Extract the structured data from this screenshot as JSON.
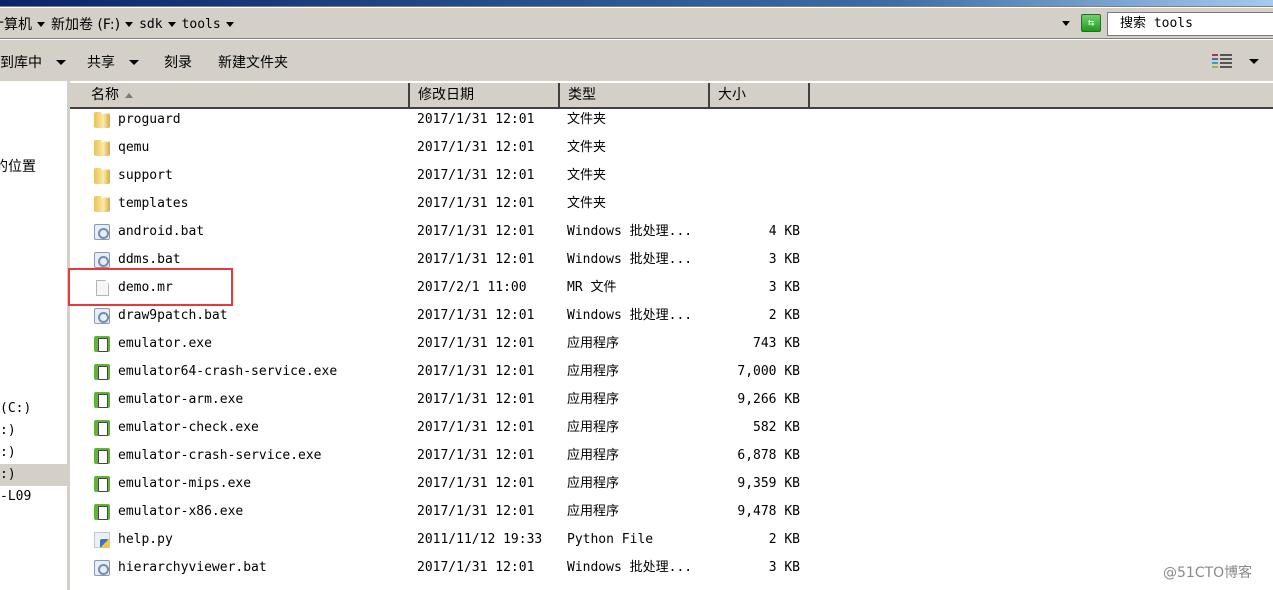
{
  "address_bar": {
    "breadcrumbs": [
      "计算机",
      "新加卷 (F:)",
      "sdk",
      "tools"
    ],
    "search_placeholder": "搜索 tools"
  },
  "toolbar": {
    "include_in_library": "包含到库中",
    "share": "共享",
    "burn": "刻录",
    "new_folder": "新建文件夹"
  },
  "sidebar": {
    "items": [
      {
        "label": "最近访问的位置",
        "visible": "的位置"
      },
      {
        "label": "本地磁盘 (C:)",
        "visible": "(C:)"
      },
      {
        "label": "(D:)",
        "visible": ":)"
      },
      {
        "label": "(E:)",
        "visible": ":)"
      },
      {
        "label": "新加卷 (F:)",
        "visible": ":)",
        "selected": true
      },
      {
        "label": "-L09",
        "visible": "-L09"
      }
    ]
  },
  "columns": {
    "name": "名称",
    "date": "修改日期",
    "type": "类型",
    "size": "大小"
  },
  "files": [
    {
      "name": "proguard",
      "date": "2017/1/31 12:01",
      "type": "文件夹",
      "size": "",
      "icon": "folder-icon"
    },
    {
      "name": "qemu",
      "date": "2017/1/31 12:01",
      "type": "文件夹",
      "size": "",
      "icon": "folder-icon"
    },
    {
      "name": "support",
      "date": "2017/1/31 12:01",
      "type": "文件夹",
      "size": "",
      "icon": "folder-icon"
    },
    {
      "name": "templates",
      "date": "2017/1/31 12:01",
      "type": "文件夹",
      "size": "",
      "icon": "folder-icon"
    },
    {
      "name": "android.bat",
      "date": "2017/1/31 12:01",
      "type": "Windows 批处理...",
      "size": "4 KB",
      "icon": "batch-file-icon"
    },
    {
      "name": "ddms.bat",
      "date": "2017/1/31 12:01",
      "type": "Windows 批处理...",
      "size": "3 KB",
      "icon": "batch-file-icon"
    },
    {
      "name": "demo.mr",
      "date": "2017/2/1 11:00",
      "type": "MR 文件",
      "size": "3 KB",
      "icon": "file-icon",
      "highlighted": true
    },
    {
      "name": "draw9patch.bat",
      "date": "2017/1/31 12:01",
      "type": "Windows 批处理...",
      "size": "2 KB",
      "icon": "batch-file-icon"
    },
    {
      "name": "emulator.exe",
      "date": "2017/1/31 12:01",
      "type": "应用程序",
      "size": "743 KB",
      "icon": "exe-icon"
    },
    {
      "name": "emulator64-crash-service.exe",
      "date": "2017/1/31 12:01",
      "type": "应用程序",
      "size": "7,000 KB",
      "icon": "exe-icon"
    },
    {
      "name": "emulator-arm.exe",
      "date": "2017/1/31 12:01",
      "type": "应用程序",
      "size": "9,266 KB",
      "icon": "exe-icon"
    },
    {
      "name": "emulator-check.exe",
      "date": "2017/1/31 12:01",
      "type": "应用程序",
      "size": "582 KB",
      "icon": "exe-icon"
    },
    {
      "name": "emulator-crash-service.exe",
      "date": "2017/1/31 12:01",
      "type": "应用程序",
      "size": "6,878 KB",
      "icon": "exe-icon"
    },
    {
      "name": "emulator-mips.exe",
      "date": "2017/1/31 12:01",
      "type": "应用程序",
      "size": "9,359 KB",
      "icon": "exe-icon"
    },
    {
      "name": "emulator-x86.exe",
      "date": "2017/1/31 12:01",
      "type": "应用程序",
      "size": "9,478 KB",
      "icon": "exe-icon"
    },
    {
      "name": "help.py",
      "date": "2011/11/12 19:33",
      "type": "Python File",
      "size": "2 KB",
      "icon": "python-file-icon"
    },
    {
      "name": "hierarchyviewer.bat",
      "date": "2017/1/31 12:01",
      "type": "Windows 批处理...",
      "size": "3 KB",
      "icon": "batch-file-icon"
    }
  ],
  "watermark": "@51CTO博客"
}
